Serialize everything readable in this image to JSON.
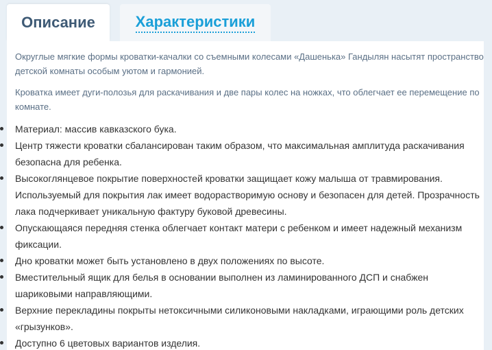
{
  "tabs": [
    {
      "label": "Описание",
      "active": true
    },
    {
      "label": "Характеристики",
      "active": false
    }
  ],
  "description": {
    "paragraphs": [
      "Округлые мягкие формы кроватки-качалки со съемными колесами «Дашенька» Гандылян насытят пространство детской комнаты особым уютом и гармонией.",
      "Кроватка имеет дуги-полозья для раскачивания и две пары колес на ножках, что облегчает ее перемещение по комнате."
    ],
    "features": [
      "Материал: массив кавказского бука.",
      "Центр тяжести кроватки сбалансирован таким образом, что максимальная амплитуда раскачивания безопасна для ребенка.",
      "Высокоглянцевое покрытие поверхностей кроватки защищает кожу малыша от травмирования. Используемый для покрытия лак имеет водорастворимую основу и безопасен для детей. Прозрачность лака подчеркивает уникальную фактуру буковой древесины.",
      "Опускающаяся передняя стенка облегчает контакт матери с ребенком и имеет надежный механизм фиксации.",
      "Дно кроватки может быть установлено в двух положениях по высоте.",
      "Вместительный ящик для белья в основании выполнен из ламинированного ДСП и снабжен шариковыми направляющими.",
      "Верхние перекладины покрыты нетоксичными силиконовыми накладками, играющими роль детских «грызунков».",
      "Доступно 6 цветовых вариантов изделия."
    ]
  },
  "colors": {
    "page_background": "#e9f0f6",
    "active_tab_text": "#3e5a75",
    "inactive_tab_text": "#1a9fd8",
    "paragraph_text": "#5a6f85",
    "list_text": "#333333"
  }
}
